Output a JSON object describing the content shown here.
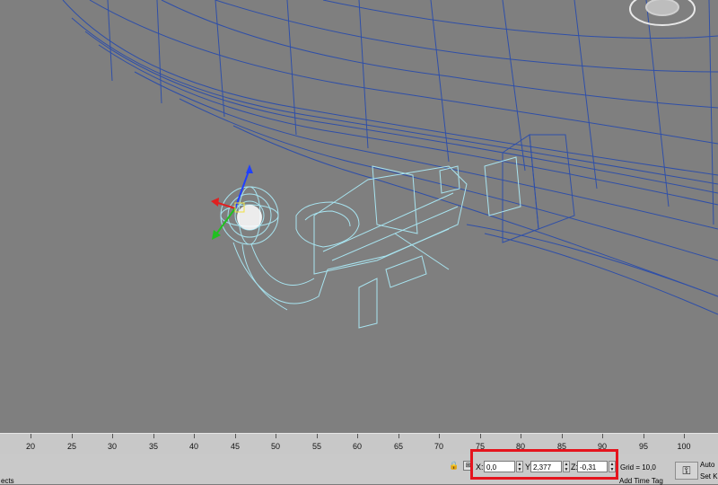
{
  "viewport": {
    "name": "3D wireframe viewport",
    "colors": {
      "background": "#7f7f7f",
      "car_wire": "#2f4fa8",
      "hitch_wire": "#a8e4f0",
      "gizmo_x": "#e02020",
      "gizmo_y": "#20c020",
      "gizmo_z": "#2040ff"
    }
  },
  "timeline": {
    "ticks": [
      "20",
      "25",
      "30",
      "35",
      "40",
      "45",
      "50",
      "55",
      "60",
      "65",
      "70",
      "75",
      "80",
      "85",
      "90",
      "95",
      "100"
    ]
  },
  "statusbar": {
    "left_text": "ects",
    "x_label": "X:",
    "x_value": "0,0",
    "y_label": "Y:",
    "y_value": "2,377",
    "z_label": "Z:",
    "z_value": "-0,31",
    "grid_text": "Grid = 10,0",
    "add_time_tag": "Add Time Tag",
    "auto_key": "Auto",
    "set_key": "Set K"
  },
  "icons": {
    "lock": "lock-icon",
    "key": "key-icon",
    "absolute_mode": "absolute-mode-icon",
    "viewcube": "viewcube-icon"
  }
}
